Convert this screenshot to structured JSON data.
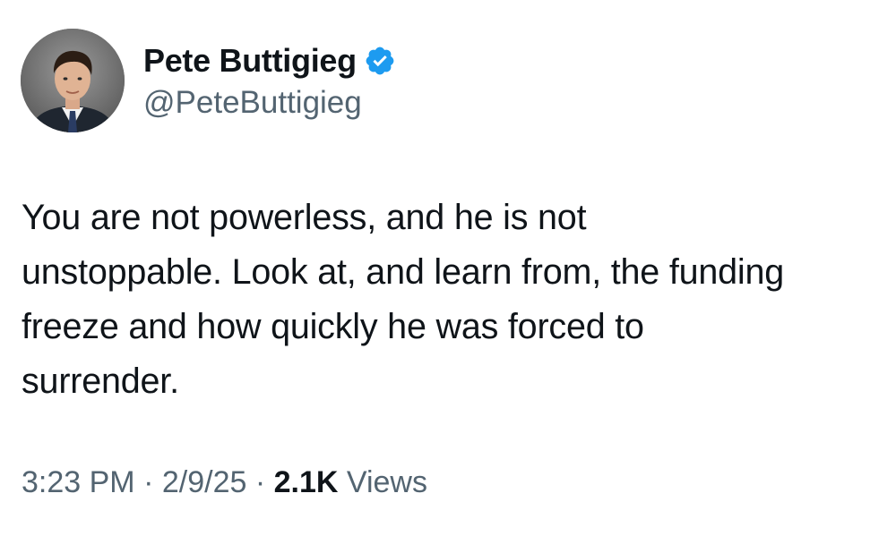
{
  "author": {
    "display_name": "Pete Buttigieg",
    "handle": "@PeteButtigieg",
    "verified_color": "#1d9bf0",
    "avatar_icon": "profile-photo"
  },
  "tweet": {
    "lines": [
      "You are not powerless, and he is not",
      "unstoppable. Look at, and learn from, the funding",
      "freeze and how quickly he was forced to",
      "surrender."
    ]
  },
  "meta": {
    "time": "3:23 PM",
    "separator": "·",
    "date": "2/9/25",
    "views_count": "2.1K",
    "views_label": "Views"
  }
}
